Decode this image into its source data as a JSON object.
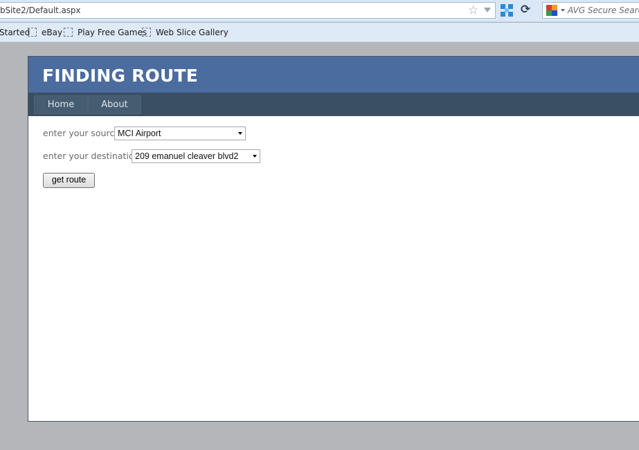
{
  "browser": {
    "url": "bSite2/Default.aspx",
    "search_placeholder": "AVG Secure Search",
    "icons": {
      "star": "star-icon",
      "url_dropdown": "chevron-down-icon",
      "speed_dial": "speed-dial-icon",
      "reload": "reload-icon",
      "search_provider": "avg-logo-icon"
    },
    "bookmarks": [
      {
        "label": "Started",
        "icon": "none"
      },
      {
        "label": "eBay",
        "icon": "bookmark-icon"
      },
      {
        "label": "Play Free Games",
        "icon": "bookmark-icon"
      },
      {
        "label": "Web Slice Gallery",
        "icon": "bookmark-icon"
      }
    ],
    "reload_glyph": "⟳",
    "star_glyph": "☆"
  },
  "page": {
    "title": "FINDING ROUTE",
    "menu": [
      {
        "label": "Home"
      },
      {
        "label": "About"
      }
    ],
    "source": {
      "label": "enter your source",
      "selected": "MCI Airport"
    },
    "destination": {
      "label": "enter your destination",
      "selected": "209 emanuel cleaver blvd2"
    },
    "button_label": "get route"
  },
  "colors": {
    "header": "#4b6c9e",
    "menu_bar": "#3a4f63",
    "menu_item": "#465c71",
    "page_background": "#b5b6ba",
    "toolbar": "#d9e7f6"
  }
}
